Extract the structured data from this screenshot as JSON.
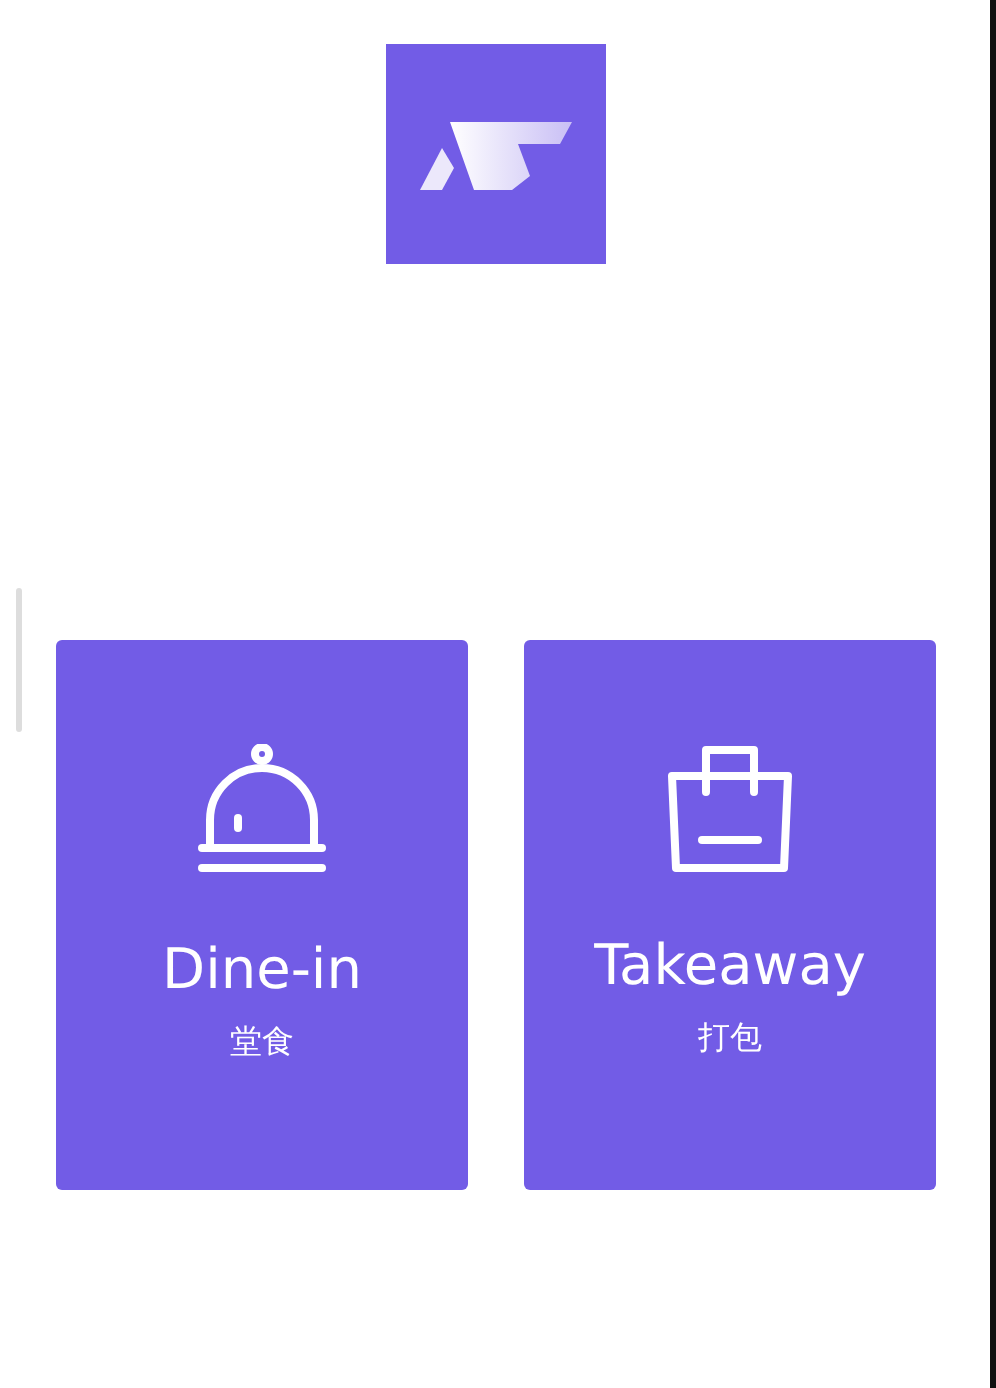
{
  "options": [
    {
      "kind": "dine_in",
      "title": "Dine-in",
      "subtitle": "堂食"
    },
    {
      "kind": "takeaway",
      "title": "Takeaway",
      "subtitle": "打包"
    }
  ]
}
